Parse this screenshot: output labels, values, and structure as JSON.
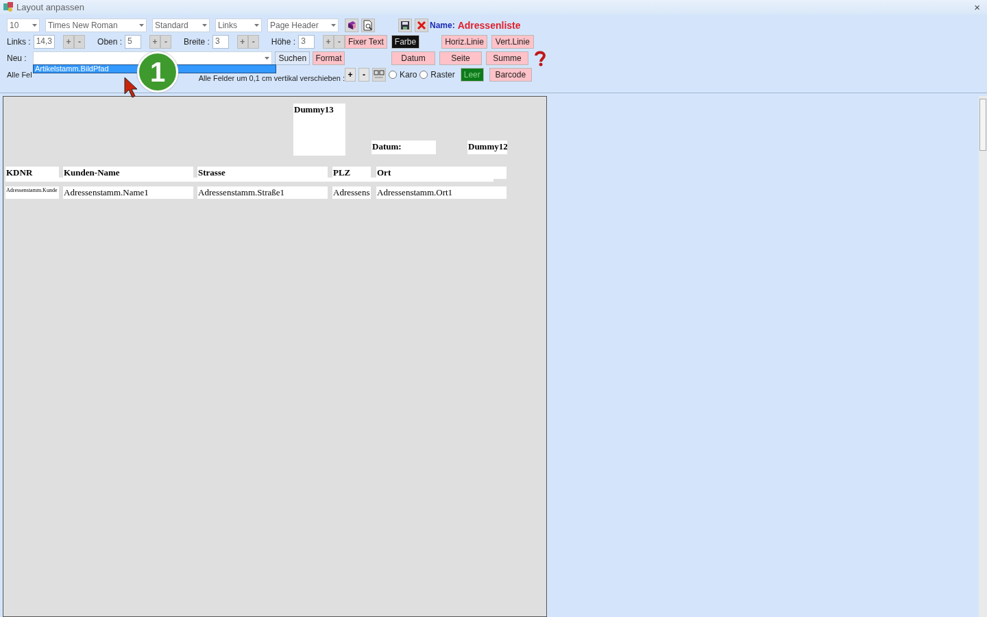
{
  "window": {
    "title": "Layout anpassen",
    "close": "×"
  },
  "format_row": [
    {
      "value": "10"
    },
    {
      "value": "Times New Roman"
    },
    {
      "value": "Standard"
    },
    {
      "value": "Links"
    },
    {
      "value": "Page Header"
    }
  ],
  "position_row": [
    {
      "label": "Links :",
      "value": "14,3",
      "steps": [
        {
          "text": "+",
          "disabled": true
        },
        {
          "text": "-",
          "disabled": true
        }
      ]
    },
    {
      "label": "Oben :",
      "value": "5",
      "steps": [
        {
          "text": "+",
          "disabled": true
        },
        {
          "text": "-",
          "disabled": true
        }
      ]
    },
    {
      "label": "Breite :",
      "value": "3",
      "steps": [
        {
          "text": "+",
          "disabled": true
        },
        {
          "text": "-",
          "disabled": true
        }
      ]
    },
    {
      "label": "Höhe :",
      "value": "3",
      "steps": [
        {
          "text": "+",
          "disabled": true
        },
        {
          "text": "-",
          "disabled": true
        }
      ]
    }
  ],
  "new_row": {
    "label": "Neu :",
    "options": [
      {
        "text": "Artikelstamm.BildPfad",
        "selected": true
      }
    ],
    "buttons": [
      {
        "text": "Suchen",
        "kind": "plain"
      },
      {
        "text": "Format",
        "kind": "pink"
      }
    ]
  },
  "shift_row": {
    "horizontal_label": "Alle Fel",
    "vertical_label": "Alle Felder um 0,1 cm vertikal verschieben :",
    "steps": [
      {
        "text": "+",
        "disabled": false
      },
      {
        "text": "-",
        "disabled": false
      }
    ],
    "radios": [
      {
        "label": "Karo",
        "checked": false
      },
      {
        "label": "Raster",
        "checked": false
      }
    ]
  },
  "report_name": {
    "label": "Name:",
    "value": "Adressenliste"
  },
  "action_buttons": [
    {
      "text": "Fixer Text",
      "kind": "pink"
    },
    {
      "text": "Farbe",
      "kind": "black"
    },
    {
      "text": "Horiz.Linie",
      "kind": "pink"
    },
    {
      "text": "Vert.Linie",
      "kind": "pink"
    },
    {
      "text": "Datum",
      "kind": "pink"
    },
    {
      "text": "Seite",
      "kind": "pink"
    },
    {
      "text": "Summe",
      "kind": "pink"
    },
    {
      "text": "Leer",
      "kind": "green"
    },
    {
      "text": "Barcode",
      "kind": "pink"
    }
  ],
  "badge": {
    "text": "1"
  },
  "report": {
    "header_fields": [
      {
        "text": "Dummy13"
      },
      {
        "text": "Datum:"
      },
      {
        "text": "Dummy12"
      }
    ],
    "column_headings": [
      {
        "text": "KDNR"
      },
      {
        "text": "Kunden-Name"
      },
      {
        "text": "Strasse"
      },
      {
        "text": "PLZ"
      },
      {
        "text": "Ort"
      }
    ],
    "detail_fields": [
      {
        "text": "Adressenstamm.Kunde"
      },
      {
        "text": "Adressenstamm.Name1"
      },
      {
        "text": "Adressenstamm.Straße1"
      },
      {
        "text": "Adressens"
      },
      {
        "text": "Adressenstamm.Ort1"
      }
    ]
  }
}
